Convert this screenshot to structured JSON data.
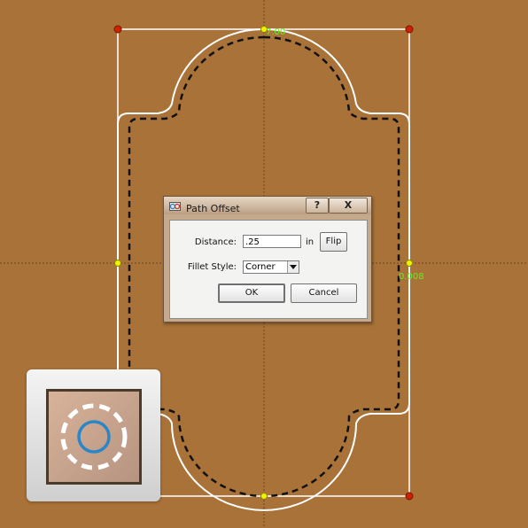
{
  "canvas": {
    "colors": {
      "background": "#a87238",
      "outline": "#ffffff",
      "offset_path": "#111111",
      "guide": "#5a3a1a",
      "corner_handle": "#cc2200",
      "mid_handle": "#f2f200",
      "dimension_text": "#66ee22"
    },
    "dimensions": {
      "top": "7.00",
      "right": "0.008"
    }
  },
  "dialog": {
    "title": "Path Offset",
    "help_label": "?",
    "close_label": "X",
    "distance_label": "Distance:",
    "distance_value": ".25",
    "distance_unit": "in",
    "flip_label": "Flip",
    "fillet_label": "Fillet Style:",
    "fillet_value": "Corner",
    "ok_label": "OK",
    "cancel_label": "Cancel"
  },
  "app_icon": {
    "icon_name": "path-offset-icon",
    "accent_color": "#2b86c8"
  }
}
